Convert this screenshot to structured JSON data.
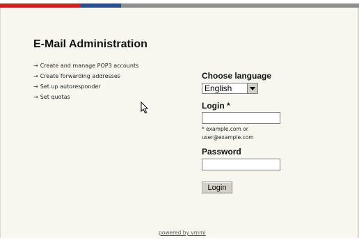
{
  "header": {
    "title": "E-Mail Administration"
  },
  "features": [
    "Create and manage POP3 accounts",
    "Create forwarding addresses",
    "Set up autoresponder",
    "Set quotas"
  ],
  "feature_arrow": "→",
  "language": {
    "label": "Choose language",
    "selected": "English"
  },
  "login": {
    "label": "Login *",
    "value": "",
    "hint_line1": "* example.com or",
    "hint_line2": "user@example.com"
  },
  "password": {
    "label": "Password",
    "value": ""
  },
  "submit": {
    "label": "Login"
  },
  "footer": {
    "powered_by": "powered by vmmi"
  },
  "colors": {
    "bar_red": "#cc2222",
    "bar_blue": "#2a4f8f",
    "bar_gray": "#8f8f8f",
    "background": "#f8f8f0"
  },
  "icons": {
    "select_arrow": "chevron-down-icon",
    "cursor": "mouse-pointer-icon"
  }
}
